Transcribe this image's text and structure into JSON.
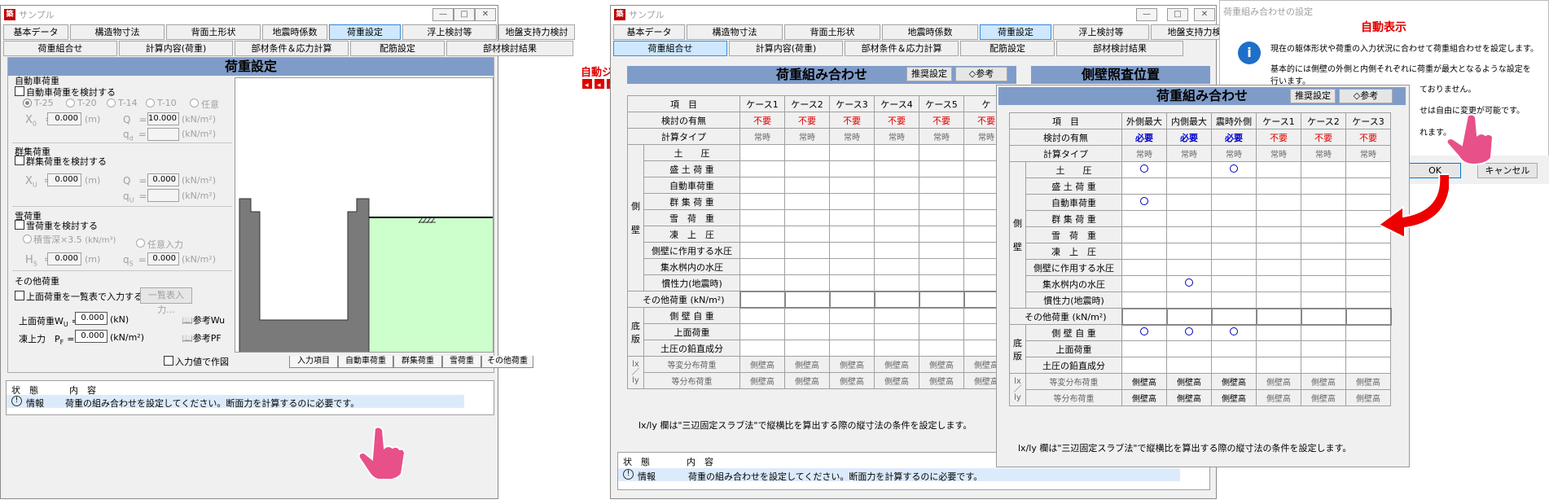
{
  "win1": {
    "title": "サンプル",
    "tabs1": [
      "基本データ",
      "構造物寸法",
      "背面土形状",
      "地震時係数",
      "荷重設定",
      "浮上検討等",
      "地盤支持力検討"
    ],
    "tabs2": [
      "荷重組合せ",
      "計算内容(荷重)",
      "部材条件＆応力計算",
      "配筋設定",
      "部材検討結果"
    ],
    "panel_title": "荷重設定",
    "car": {
      "group": "自動車荷重",
      "check": "自動車荷重を検討する",
      "radios": [
        "T-25",
        "T-20",
        "T-14",
        "T-10",
        "任意"
      ],
      "x0_label": "X",
      "x0_sub": "0",
      "x0_eq": "=",
      "x0": "0.000",
      "x0_unit": "(m)",
      "q_label": "Q",
      "q_eq": "=",
      "q": "10.000",
      "q_unit": "(kN/m²)",
      "qd_label": "q",
      "qd_sub": "d",
      "qd_eq": "=",
      "qd_unit": "(kN/m²)"
    },
    "crowd": {
      "group": "群集荷重",
      "check": "群集荷重を検討する",
      "xu_label": "X",
      "xu_sub": "U",
      "xu_eq": "=",
      "xu": "0.000",
      "xu_unit": "(m)",
      "q_label": "Q",
      "q_eq": "=",
      "q": "0.000",
      "q_unit": "(kN/m²)",
      "qu_label": "q",
      "qu_sub": "U",
      "qu_eq": "=",
      "qu_unit": "(kN/m²)"
    },
    "snow": {
      "group": "雪荷重",
      "check": "雪荷重を検討する",
      "r1": "積雪深×3.5",
      "r1_unit": "(kN/m³)",
      "r2": "任意入力",
      "hs_label": "H",
      "hs_sub": "S",
      "hs_eq": "=",
      "hs": "0.000",
      "hs_unit": "(m)",
      "qs_label": "q",
      "qs_sub": "S",
      "qs_eq": "=",
      "qs": "0.000",
      "qs_unit": "(kN/m²)"
    },
    "other": {
      "group": "その他荷重",
      "check": "上面荷重を一覧表で入力する",
      "list_btn": "一覧表入力...",
      "wu_label": "上面荷重W",
      "wu_sub": "U",
      "wu_eq": "=",
      "wu": "0.000",
      "wu_unit": "(kN)",
      "ref_wu": "参考Wu",
      "pf_label": "凍上力　P",
      "pf_sub": "F",
      "pf_eq": "=",
      "pf": "0.000",
      "pf_unit": "(kN/m²)",
      "ref_pf": "参考PF"
    },
    "draw_check": "入力値で作図",
    "bottom_tabs": [
      "入力項目",
      "自動車荷重",
      "群集荷重",
      "雪荷重",
      "その他荷重"
    ],
    "status": {
      "h1": "状　態",
      "h2": "内　容",
      "type": "情報",
      "msg": "荷重の組み合わせを設定してください。断面力を計算するのに必要です。"
    }
  },
  "jump": "自動ジャンプ",
  "win2": {
    "title": "サンプル",
    "tabs1": [
      "基本データ",
      "構造物寸法",
      "背面土形状",
      "地震時係数",
      "荷重設定",
      "浮上検討等",
      "地盤支持力検討"
    ],
    "tabs2": [
      "荷重組合せ",
      "計算内容(荷重)",
      "部材条件＆応力計算",
      "配筋設定",
      "部材検討結果"
    ],
    "panel_title": "荷重組み合わせ",
    "rec_btn": "推奨設定",
    "ref_btn": "参考",
    "right_title": "側壁照査位置",
    "cols": [
      "ケース1",
      "ケース2",
      "ケース3",
      "ケース4",
      "ケース5",
      "ケ"
    ],
    "note": "lx/ly 欄は\"三辺固定スラブ法\"で縦横比を算出する際の縦寸法の条件を設定します。",
    "status": {
      "h1": "状　態",
      "h2": "内　容",
      "type": "情報",
      "msg": "荷重の組み合わせを設定してください。断面力を計算するのに必要です。"
    }
  },
  "grid": {
    "item_head": "項　目",
    "row_check": "検討の有無",
    "row_calc": "計算タイプ",
    "side_label": [
      "側",
      "壁"
    ],
    "bottom_label": [
      "底",
      "版"
    ],
    "lxly_label": [
      "lx",
      "／",
      "ly"
    ],
    "side_rows": [
      "土　　圧",
      "盛 土 荷 重",
      "自動車荷重",
      "群 集 荷 重",
      "雪　荷　重",
      "凍　上　圧",
      "側壁に作用する水圧",
      "集水桝内の水圧",
      "慣性力(地震時)"
    ],
    "other_row": "その他荷重 (kN/m²)",
    "bottom_rows": [
      "側 壁 自 重",
      "上面荷重",
      "土圧の鉛直成分"
    ],
    "lx_rows": [
      "等変分布荷重",
      "等分布荷重"
    ],
    "val_need": "必要",
    "val_no": "不要",
    "val_normal": "常時",
    "val_wall": "側壁高"
  },
  "win3": {
    "title": "荷重組み合わせ",
    "rec_btn": "推奨設定",
    "ref_btn": "参考",
    "cols": [
      "外側最大",
      "内側最大",
      "震時外側",
      "ケース1",
      "ケース2",
      "ケース3"
    ],
    "note": "lx/ly 欄は\"三辺固定スラブ法\"で縦横比を算出する際の縦寸法の条件を設定します。"
  },
  "dialog": {
    "title": "荷重組み合わせの設定",
    "heading": "自動表示",
    "msg1": "現在の躯体形状や荷重の入力状況に合わせて荷重組合わせを設定します。",
    "msg2": "基本的には側壁の外側と内側それぞれに荷重が最大となるような設定を行います。",
    "msg3": "ておりません。",
    "msg4": "せは自由に変更が可能です。",
    "msg5": "れます。",
    "ok": "OK",
    "cancel": "キャンセル"
  }
}
